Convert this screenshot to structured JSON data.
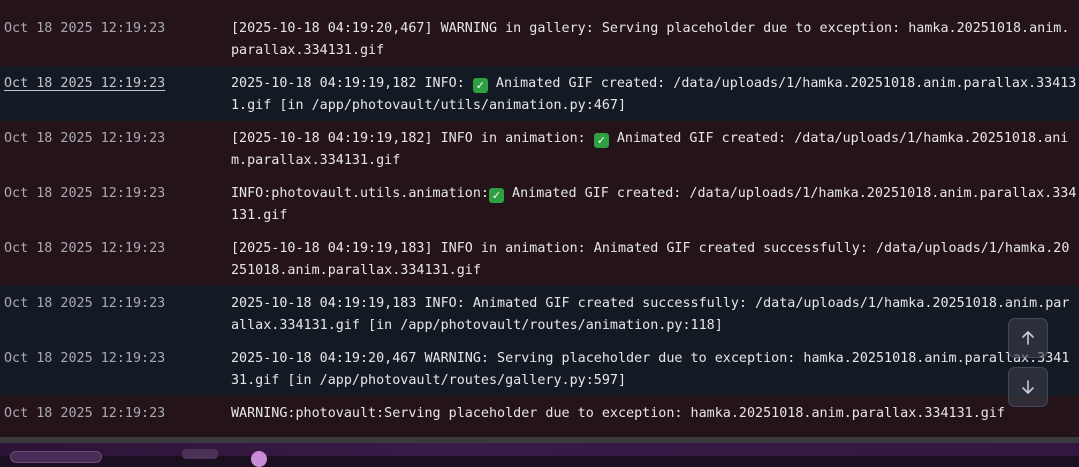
{
  "log": {
    "partial_previous": "    ",
    "rows": [
      {
        "level": "warn",
        "timestamp": "Oct 18 2025 12:19:23",
        "message_before": "[2025-10-18 04:19:20,467] WARNING in gallery: Serving placeholder due to exception: hamka.20251018.anim.parallax.334131.gif",
        "message_after": ""
      },
      {
        "level": "info",
        "timestamp": "Oct 18 2025 12:19:23",
        "message_before": "2025-10-18 04:19:19,182 INFO: ",
        "message_after": " Animated GIF created: /data/uploads/1/hamka.20251018.anim.parallax.334131.gif [in /app/photovault/utils/animation.py:467]"
      },
      {
        "level": "warn",
        "timestamp": "Oct 18 2025 12:19:23",
        "message_before": "[2025-10-18 04:19:19,182] INFO in animation: ",
        "message_after": " Animated GIF created: /data/uploads/1/hamka.20251018.anim.parallax.334131.gif"
      },
      {
        "level": "warn",
        "timestamp": "Oct 18 2025 12:19:23",
        "message_before": "INFO:photovault.utils.animation:",
        "message_after": " Animated GIF created: /data/uploads/1/hamka.20251018.anim.parallax.334131.gif"
      },
      {
        "level": "warn",
        "timestamp": "Oct 18 2025 12:19:23",
        "message_before": "[2025-10-18 04:19:19,183] INFO in animation: Animated GIF created successfully: /data/uploads/1/hamka.20251018.anim.parallax.334131.gif",
        "message_after": ""
      },
      {
        "level": "info",
        "timestamp": "Oct 18 2025 12:19:23",
        "message_before": "2025-10-18 04:19:19,183 INFO: Animated GIF created successfully: /data/uploads/1/hamka.20251018.anim.parallax.334131.gif [in /app/photovault/routes/animation.py:118]",
        "message_after": ""
      },
      {
        "level": "info",
        "timestamp": "Oct 18 2025 12:19:23",
        "message_before": "2025-10-18 04:19:20,467 WARNING: Serving placeholder due to exception: hamka.20251018.anim.parallax.334131.gif [in /app/photovault/routes/gallery.py:597]",
        "message_after": ""
      },
      {
        "level": "warn",
        "timestamp": "Oct 18 2025 12:19:23",
        "message_before": "WARNING:photovault:Serving placeholder due to exception: hamka.20251018.anim.parallax.334131.gif",
        "message_after": ""
      }
    ],
    "check_glyph": "✓"
  },
  "scroll_controls": {
    "up_icon": "arrow-up-icon",
    "down_icon": "arrow-down-icon"
  },
  "colors": {
    "warn_row_bg": "#24141a",
    "info_row_bg": "#141a24",
    "check_green": "#2ea043"
  }
}
